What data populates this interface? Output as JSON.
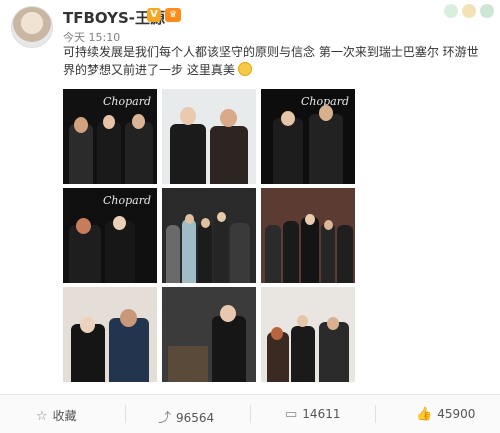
{
  "post": {
    "username": "TFBOYS-王源",
    "timestamp": "今天 15:10",
    "text": "可持续发展是我们每个人都该坚守的原则与信念 第一次来到瑞士巴塞尔 环游世界的梦想又前进了一步 这里真美",
    "badges": {
      "verified": "V",
      "crown": "♛"
    }
  },
  "photos": [
    {
      "caption": "Chopard"
    },
    {
      "caption": ""
    },
    {
      "caption": "Chopard"
    },
    {
      "caption": "Chopard"
    },
    {
      "caption": ""
    },
    {
      "caption": ""
    },
    {
      "caption": ""
    },
    {
      "caption": ""
    },
    {
      "caption": ""
    }
  ],
  "actions": {
    "favorite": {
      "label": "收藏",
      "icon": "star-icon"
    },
    "repost": {
      "count": "96564",
      "icon": "repost-icon"
    },
    "comment": {
      "count": "14611",
      "icon": "comment-icon"
    },
    "like": {
      "count": "45900",
      "icon": "thumbs-up-icon"
    }
  },
  "colors": {
    "accent": "#f5a623",
    "text": "#333333",
    "muted": "#808080"
  }
}
